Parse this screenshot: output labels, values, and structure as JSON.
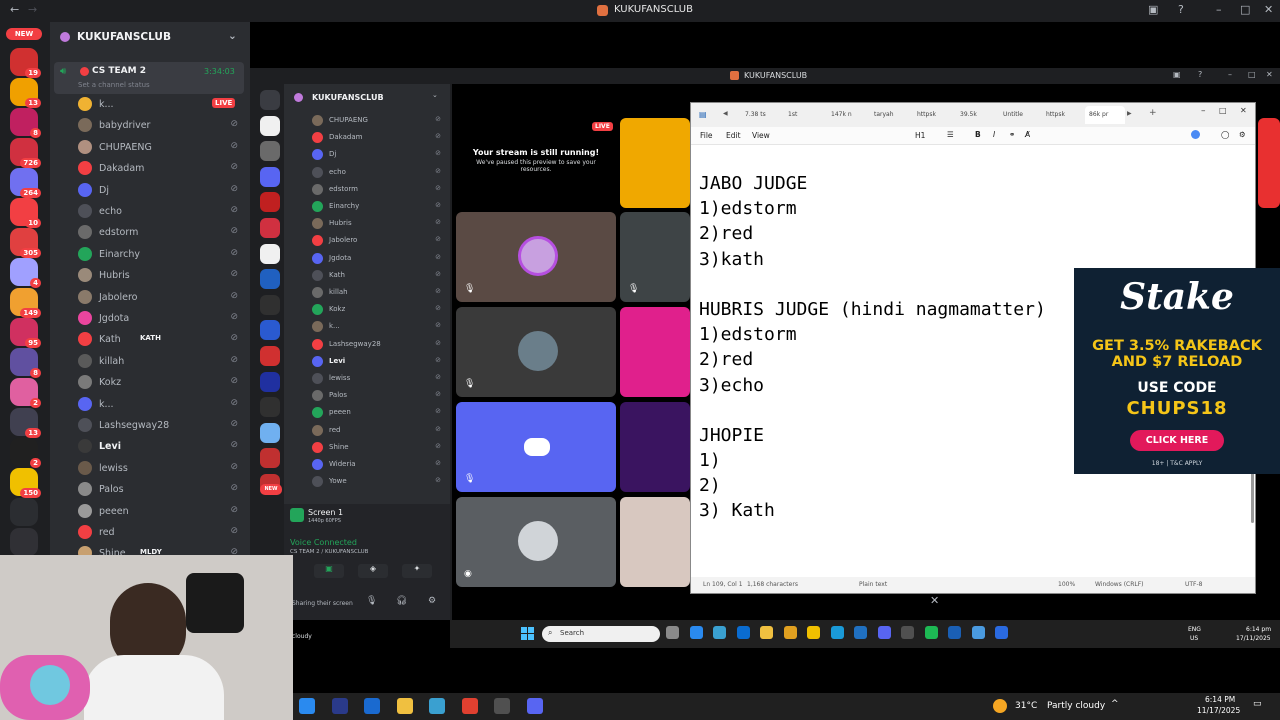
{
  "app": {
    "window_title": "KUKUFANSCLUB",
    "inner_window_title": "KUKUFANSCLUB"
  },
  "colors": {
    "discord_bg": "#2b2d31",
    "rail_bg": "#1e1f22",
    "live_red": "#f23f43",
    "blurple": "#5865f2",
    "voice_green": "#23a55a",
    "stake_bg": "#0f2133",
    "stake_yellow": "#f5c518",
    "stake_pink": "#e2195b"
  },
  "rail": {
    "new_label": "NEW",
    "badges": [
      "19",
      "13",
      "8",
      "726",
      "264",
      "10",
      "305",
      "4",
      "149",
      "95",
      "8",
      "2",
      "13",
      "2",
      "150"
    ]
  },
  "channels": {
    "server_name": "KUKUFANSCLUB",
    "voice_channel": "CS TEAM 2",
    "voice_time": "3:34:03",
    "status_placeholder": "Set a channel status",
    "live_label": "LIVE",
    "members": [
      {
        "name": "k...",
        "status": "LIVE",
        "color": "#f0b232"
      },
      {
        "name": "babydriver",
        "status": "",
        "color": "#7a6a5a"
      },
      {
        "name": "CHUPAENG",
        "status": "",
        "color": "#b09080"
      },
      {
        "name": "Dakadam",
        "status": "",
        "color": "#f23f43"
      },
      {
        "name": "Dj",
        "status": "",
        "color": "#5865f2"
      },
      {
        "name": "echo",
        "status": "",
        "color": "#4e5058"
      },
      {
        "name": "edstorm",
        "status": "",
        "color": "#6a6a6a"
      },
      {
        "name": "Einarchy",
        "status": "",
        "color": "#23a55a"
      },
      {
        "name": "Hubris",
        "status": "",
        "color": "#9a8a7a"
      },
      {
        "name": "Jabolero",
        "status": "",
        "color": "#8a7a6a"
      },
      {
        "name": "Jgdota",
        "status": "",
        "color": "#eb459e"
      },
      {
        "name": "Kath",
        "status": "KATH",
        "color": "#f23f43"
      },
      {
        "name": "killah",
        "status": "",
        "color": "#5a5a5a"
      },
      {
        "name": "Kokz",
        "status": "",
        "color": "#7a7a7a"
      },
      {
        "name": "k...",
        "status": "",
        "color": "#5865f2"
      },
      {
        "name": "Lashsegway28",
        "status": "",
        "color": "#4e5058"
      },
      {
        "name": "Levi",
        "status": "",
        "color": "#3a3a3a"
      },
      {
        "name": "lewiss",
        "status": "",
        "color": "#6a5a4a"
      },
      {
        "name": "Palos",
        "status": "",
        "color": "#8a8a8a"
      },
      {
        "name": "peeen",
        "status": "",
        "color": "#9a9a9a"
      },
      {
        "name": "red",
        "status": "",
        "color": "#f23f43"
      },
      {
        "name": "Shine",
        "status": "MLDY",
        "color": "#c8a070"
      }
    ]
  },
  "inner_channels": {
    "server_name": "KUKUFANSCLUB",
    "members": [
      {
        "name": "CHUPAENG"
      },
      {
        "name": "Dakadam"
      },
      {
        "name": "Dj"
      },
      {
        "name": "echo"
      },
      {
        "name": "edstorm"
      },
      {
        "name": "Einarchy"
      },
      {
        "name": "Hubris"
      },
      {
        "name": "Jabolero"
      },
      {
        "name": "Jgdota"
      },
      {
        "name": "Kath"
      },
      {
        "name": "killah"
      },
      {
        "name": "Kokz"
      },
      {
        "name": "k..."
      },
      {
        "name": "Lashsegway28"
      },
      {
        "name": "Levi"
      },
      {
        "name": "lewiss"
      },
      {
        "name": "Palos"
      },
      {
        "name": "peeen"
      },
      {
        "name": "red"
      },
      {
        "name": "Shine"
      },
      {
        "name": "Wideria"
      },
      {
        "name": "Yowe"
      }
    ],
    "screen_label": "Screen 1",
    "screen_sub": "1440p 60FPS",
    "voice_connected": "Voice Connected",
    "voice_sub": "CS TEAM 2 / KUKUFANSCLUB",
    "sharing": "Sharing their screen",
    "new_label": "NEW"
  },
  "stream": {
    "title": "Your stream is still running!",
    "subtitle": "We've paused this preview to save your resources.",
    "live_label": "LIVE"
  },
  "notepad": {
    "tabs": [
      "7.38 ts",
      "1st",
      "147k n",
      "taryah",
      "httpsk",
      "39.5k",
      "Untitle",
      "httpsk",
      "86k pr"
    ],
    "menu": [
      "File",
      "Edit",
      "View"
    ],
    "heading_label": "H1",
    "lines": [
      "JABO JUDGE",
      "1)edstorm",
      "2)red",
      "3)kath",
      "",
      "HUBRIS JUDGE (hindi nagmamatter)",
      "1)edstorm",
      "2)red",
      "3)echo",
      "",
      "JHOPIE",
      "1)",
      "2)",
      "3) Kath"
    ],
    "status": {
      "position": "Ln 109, Col 1",
      "chars": "1,168 characters",
      "format": "Plain text",
      "zoom": "100%",
      "eol": "Windows (CRLF)",
      "encoding": "UTF-8"
    }
  },
  "ad": {
    "brand": "Stake",
    "line1": "GET 3.5% RAKEBACK",
    "line2": "AND $7 RELOAD",
    "use_code": "USE CODE",
    "code": "CHUPS18",
    "cta": "CLICK HERE",
    "disclaimer": "18+ | T&C APPLY"
  },
  "inner_taskbar": {
    "search_placeholder": "Search",
    "lang": "ENG",
    "region": "US",
    "time": "6:14 pm",
    "date": "17/11/2025",
    "weather": "cloudy"
  },
  "taskbar": {
    "temp": "31°C",
    "weather": "Partly cloudy",
    "time": "6:14 PM",
    "date": "11/17/2025"
  }
}
